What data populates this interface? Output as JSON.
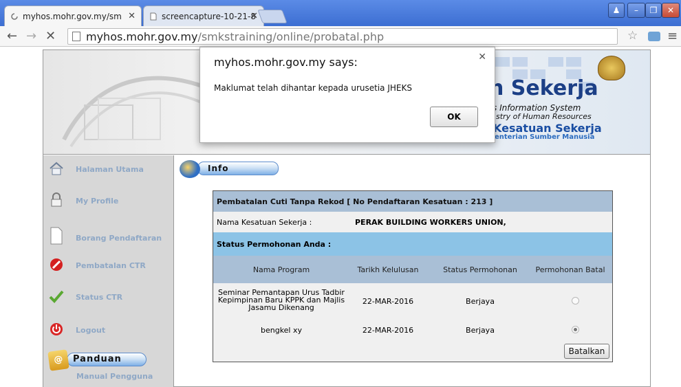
{
  "browser": {
    "tabs": [
      {
        "label": "myhos.mohr.gov.my/sm"
      },
      {
        "label": "screencapture-10-21-8"
      }
    ],
    "url_host": "myhos.mohr.gov.my",
    "url_path": "/smkstraining/online/probatal.php"
  },
  "banner": {
    "title_fragment": "n Sekerja",
    "subtitle1": "s Information System",
    "subtitle2": "stry of Human Resources",
    "ks_title": "Kesatuan Sekerja",
    "ks_sub": "enterian Sumber Manusia"
  },
  "sidebar": {
    "items": [
      {
        "label": "Halaman Utama",
        "icon": "home-icon"
      },
      {
        "label": "My Profile",
        "icon": "lock-icon"
      },
      {
        "label": "Borang Pendaftaran",
        "icon": "document-icon"
      },
      {
        "label": "Pembatalan CTR",
        "icon": "cancel-icon"
      },
      {
        "label": "Status CTR",
        "icon": "checkmark-icon"
      },
      {
        "label": "Logout",
        "icon": "power-icon"
      }
    ],
    "panduan_label": "Panduan",
    "manual_label": "Manual Pengguna"
  },
  "main": {
    "section_label": "Info",
    "panel_title": "Pembatalan Cuti Tanpa Rekod [ No Pendaftaran Kesatuan : 213 ]",
    "nama_label": "Nama Kesatuan Sekerja :",
    "nama_value": "PERAK BUILDING WORKERS UNION,",
    "status_heading": "Status Permohonan Anda :",
    "columns": [
      "Nama Program",
      "Tarikh Kelulusan",
      "Status Permohonan",
      "Permohonan Batal"
    ],
    "rows": [
      {
        "program": "Seminar Pemantapan Urus Tadbir Kepimpinan Baru KPPK dan Majlis Jasamu Dikenang",
        "tarikh": "22-MAR-2016",
        "status": "Berjaya",
        "selected": false
      },
      {
        "program": "bengkel xy",
        "tarikh": "22-MAR-2016",
        "status": "Berjaya",
        "selected": true
      }
    ],
    "batal_button": "Batalkan"
  },
  "dialog": {
    "title": "myhos.mohr.gov.my says:",
    "message": "Maklumat telah dihantar kepada urusetia JHEKS",
    "ok_label": "OK"
  },
  "colors": {
    "header_row": "#a9bfd6",
    "status_row": "#8cc3e6",
    "sidebar_bg": "#d7d7d7",
    "sidebar_text": "#8fa8c6"
  }
}
